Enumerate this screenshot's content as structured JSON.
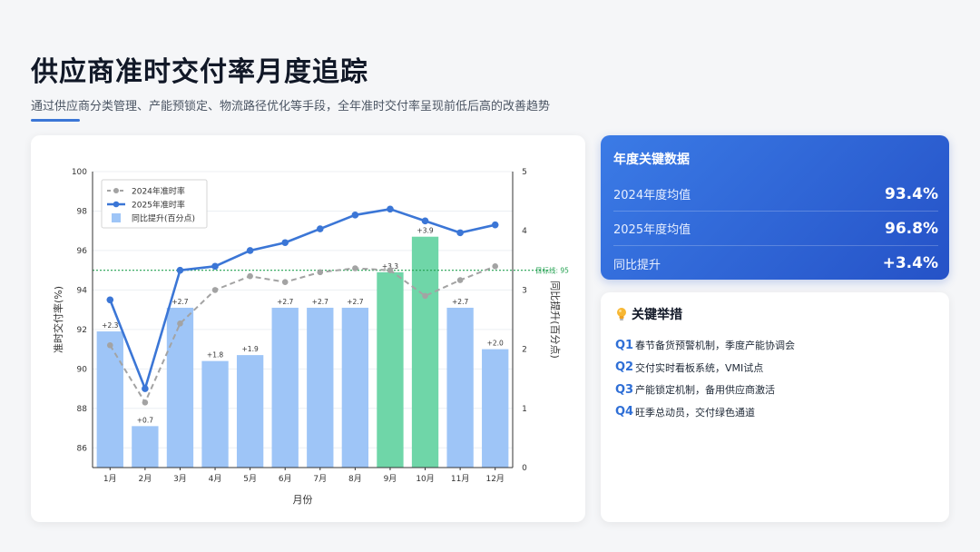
{
  "header": {
    "title": "供应商准时交付率月度追踪",
    "subtitle": "通过供应商分类管理、产能预锁定、物流路径优化等手段，全年准时交付率呈现前低后高的改善趋势"
  },
  "colors": {
    "accent": "#3b76d6",
    "line_2025": "#3b76d6",
    "line_2024": "#a3a3a3",
    "bar_normal": "#9ec5f7",
    "bar_highlight": "#6fd6a8",
    "target_line": "#22a050"
  },
  "chart_data": {
    "type": "bar",
    "categories": [
      "1月",
      "2月",
      "3月",
      "4月",
      "5月",
      "6月",
      "7月",
      "8月",
      "9月",
      "10月",
      "11月",
      "12月"
    ],
    "xlabel": "月份",
    "ylabel": "准时交付率(%)",
    "y2label": "同比提升(百分点)",
    "ylim": [
      85,
      100
    ],
    "y2lim": [
      0,
      5
    ],
    "yticks": [
      86,
      88,
      90,
      92,
      94,
      96,
      98,
      100
    ],
    "y2ticks": [
      0,
      1,
      2,
      3,
      4,
      5
    ],
    "series": [
      {
        "name": "2024年准时率",
        "type": "line",
        "axis": "left",
        "style": "dashed",
        "values": [
          91.2,
          88.3,
          92.3,
          94.0,
          94.7,
          94.4,
          94.9,
          95.1,
          95.0,
          93.7,
          94.5,
          95.2
        ]
      },
      {
        "name": "2025年准时率",
        "type": "line",
        "axis": "left",
        "style": "solid",
        "values": [
          93.5,
          89.0,
          95.0,
          95.2,
          96.0,
          96.4,
          97.1,
          97.8,
          98.1,
          97.5,
          96.9,
          97.3
        ]
      },
      {
        "name": "同比提升(百分点)",
        "type": "bar",
        "axis": "right",
        "values": [
          2.3,
          0.7,
          2.7,
          1.8,
          1.9,
          2.7,
          2.7,
          2.7,
          3.3,
          3.9,
          2.7,
          2.0
        ],
        "labels": [
          "+2.3",
          "+0.7",
          "+2.7",
          "+1.8",
          "+1.9",
          "+2.7",
          "+2.7",
          "+2.7",
          "+3.3",
          "+3.9",
          "+2.7",
          "+2.0"
        ],
        "highlight": [
          8,
          9
        ]
      }
    ],
    "target": {
      "value": 95,
      "label": "目标线: 95"
    },
    "legend_position": "top-left",
    "grid": true
  },
  "stats": {
    "title": "年度关键数据",
    "rows": [
      {
        "label": "2024年度均值",
        "value": "93.4%"
      },
      {
        "label": "2025年度均值",
        "value": "96.8%"
      },
      {
        "label": "同比提升",
        "value": "+3.4%"
      }
    ]
  },
  "actions": {
    "title": "关键举措",
    "icon": "lightbulb-icon",
    "items": [
      {
        "q": "Q1",
        "text": "春节备货预警机制，季度产能协调会"
      },
      {
        "q": "Q2",
        "text": "交付实时看板系统，VMI试点"
      },
      {
        "q": "Q3",
        "text": "产能锁定机制，备用供应商激活"
      },
      {
        "q": "Q4",
        "text": "旺季总动员，交付绿色通道"
      }
    ]
  }
}
